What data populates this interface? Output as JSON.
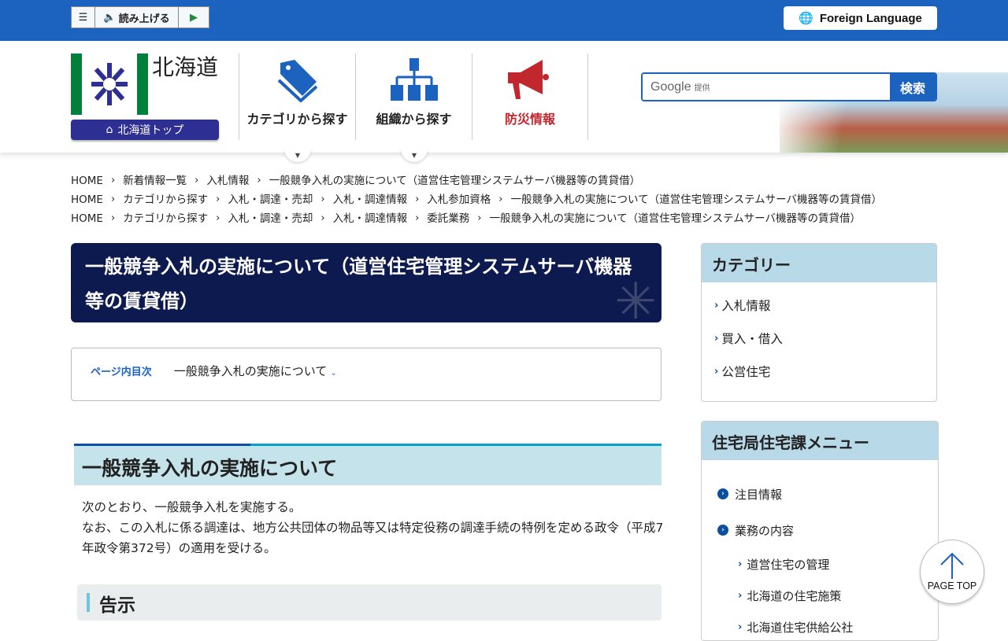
{
  "topbar": {
    "tts_label": "読み上げる",
    "foreign_language": "Foreign Language",
    "brand_color": "#1c62bf"
  },
  "header": {
    "pref_name": "北海道",
    "top_link": "北海道トップ",
    "nav": [
      {
        "label": "カテゴリから探す",
        "icon": "tag-icon"
      },
      {
        "label": "組織から探す",
        "icon": "org-chart-icon"
      },
      {
        "label": "防災情報",
        "icon": "megaphone-icon",
        "color": "#c1272d"
      }
    ],
    "search": {
      "provider": "Google",
      "provider_suffix": "提供",
      "button": "検索"
    }
  },
  "breadcrumbs": [
    [
      "HOME",
      "新着情報一覧",
      "入札情報",
      "一般競争入札の実施について（道営住宅管理システムサーバ機器等の賃貸借）"
    ],
    [
      "HOME",
      "カテゴリから探す",
      "入札・調達・売却",
      "入札・調達情報",
      "入札参加資格",
      "一般競争入札の実施について（道営住宅管理システムサーバ機器等の賃貸借）"
    ],
    [
      "HOME",
      "カテゴリから探す",
      "入札・調達・売却",
      "入札・調達情報",
      "委託業務",
      "一般競争入札の実施について（道営住宅管理システムサーバ機器等の賃貸借）"
    ]
  ],
  "main": {
    "title": "一般競争入札の実施について（道営住宅管理システムサーバ機器等の賃貸借）",
    "toc": {
      "label": "ページ内目次",
      "item": "一般競争入札の実施について"
    },
    "h2": "一般競争入札の実施について",
    "para1": "次のとおり、一般競争入札を実施する。",
    "para2": "なお、この入札に係る調達は、地方公共団体の物品等又は特定役務の調達手続の特例を定める政令（平成7年政令第372号）の適用を受ける。",
    "h3": "告示"
  },
  "sidebar": {
    "category": {
      "title": "カテゴリー",
      "items": [
        "入札情報",
        "買入・借入",
        "公営住宅"
      ]
    },
    "menu": {
      "title": "住宅局住宅課メニュー",
      "items": [
        {
          "label": "注目情報",
          "level": 1
        },
        {
          "label": "業務の内容",
          "level": 1
        },
        {
          "label": "道営住宅の管理",
          "level": 2
        },
        {
          "label": "北海道の住宅施策",
          "level": 2
        },
        {
          "label": "北海道住宅供給公社",
          "level": 2
        }
      ]
    }
  },
  "page_top": "PAGE TOP"
}
